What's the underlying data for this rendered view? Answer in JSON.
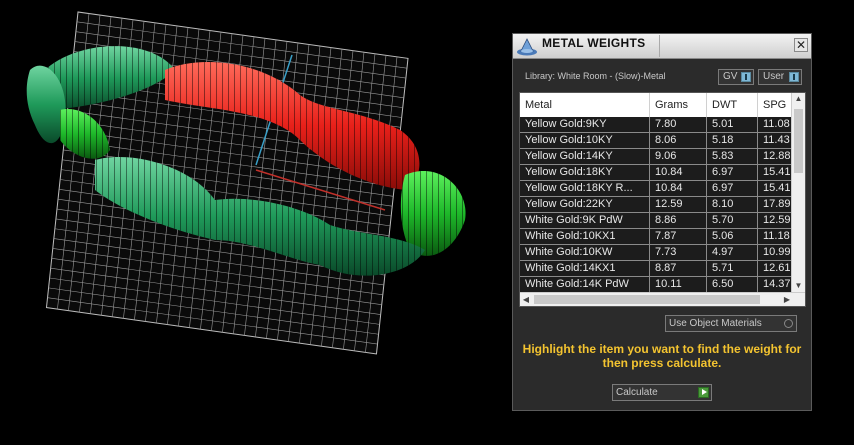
{
  "panel": {
    "title": "METAL WEIGHTS",
    "close_label": "✕",
    "library_label": "Library: White Room - (Slow)-Metal",
    "gv_label": "GV",
    "user_label": "User",
    "columns": [
      "Metal",
      "Grams",
      "DWT",
      "SPG"
    ],
    "rows": [
      [
        "Yellow Gold:9KY",
        "7.80",
        "5.01",
        "11.08"
      ],
      [
        "Yellow Gold:10KY",
        "8.06",
        "5.18",
        "11.43"
      ],
      [
        "Yellow Gold:14KY",
        "9.06",
        "5.83",
        "12.88"
      ],
      [
        "Yellow Gold:18KY",
        "10.84",
        "6.97",
        "15.41"
      ],
      [
        "Yellow Gold:18KY R...",
        "10.84",
        "6.97",
        "15.41"
      ],
      [
        "Yellow Gold:22KY",
        "12.59",
        "8.10",
        "17.89"
      ],
      [
        "White Gold:9K PdW",
        "8.86",
        "5.70",
        "12.59"
      ],
      [
        "White Gold:10KX1",
        "7.87",
        "5.06",
        "11.18"
      ],
      [
        "White Gold:10KW",
        "7.73",
        "4.97",
        "10.99"
      ],
      [
        "White Gold:14KX1",
        "8.87",
        "5.71",
        "12.61"
      ],
      [
        "White Gold:14K PdW",
        "10.11",
        "6.50",
        "14.37"
      ]
    ],
    "use_object_materials_label": "Use Object Materials",
    "instruction": "Highlight the item you want to find the weight for then press calculate.",
    "calculate_label": "Calculate"
  },
  "colors": {
    "instruction_text": "#f4c430",
    "ring_red": "#e8201a",
    "ring_green": "#1f9a5a",
    "grid": "#cfcfcf"
  }
}
